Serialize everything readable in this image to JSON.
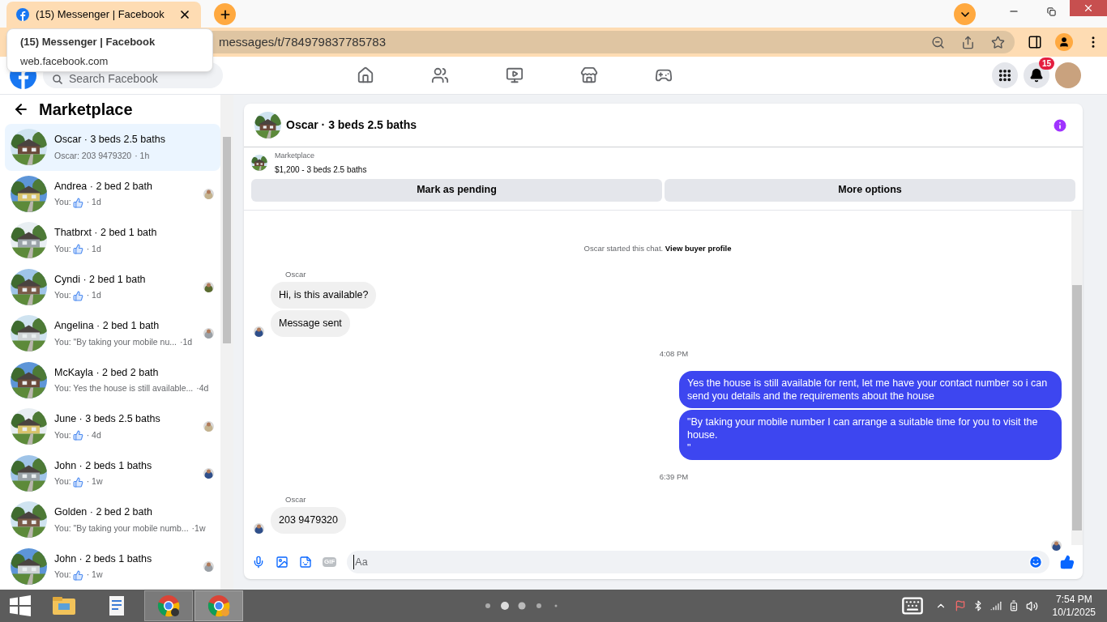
{
  "browser": {
    "tab_title": "(15) Messenger | Facebook",
    "tooltip": {
      "title": "(15) Messenger | Facebook",
      "url": "web.facebook.com"
    },
    "address": "messages/t/784979837785783"
  },
  "facebook": {
    "search_placeholder": "Search Facebook",
    "notification_count": "15"
  },
  "sidebar": {
    "title": "Marketplace",
    "conversations": [
      {
        "title": "Oscar · 3 beds 2.5 baths",
        "kind": "text",
        "preview": "Oscar: 203 9479320",
        "time": "· 1h",
        "selected": true,
        "receipt": false
      },
      {
        "title": "Andrea · 2 bed 2 bath",
        "kind": "like",
        "preview": "You:",
        "time": "· 1d",
        "selected": false,
        "receipt": true
      },
      {
        "title": "Thatbrxt · 2 bed 1 bath",
        "kind": "like",
        "preview": "You:",
        "time": "· 1d",
        "selected": false,
        "receipt": false
      },
      {
        "title": "Cyndi · 2 bed 1 bath",
        "kind": "like",
        "preview": "You:",
        "time": "· 1d",
        "selected": false,
        "receipt": true
      },
      {
        "title": "Angelina · 2 bed 1 bath",
        "kind": "text",
        "preview": "You: \"By taking your mobile nu...",
        "time": "·1d",
        "selected": false,
        "receipt": true
      },
      {
        "title": "McKayla · 2 bed 2 bath",
        "kind": "text",
        "preview": "You: Yes the house is still available...",
        "time": "·4d",
        "selected": false,
        "receipt": false
      },
      {
        "title": "June · 3 beds 2.5 baths",
        "kind": "like",
        "preview": "You:",
        "time": "· 4d",
        "selected": false,
        "receipt": true
      },
      {
        "title": "John · 2 beds 1 baths",
        "kind": "like",
        "preview": "You:",
        "time": "· 1w",
        "selected": false,
        "receipt": true
      },
      {
        "title": "Golden · 2 bed 2 bath",
        "kind": "text",
        "preview": "You: \"By taking your mobile numb...",
        "time": "·1w",
        "selected": false,
        "receipt": false
      },
      {
        "title": "John · 2 beds 1 baths",
        "kind": "like",
        "preview": "You:",
        "time": "· 1w",
        "selected": false,
        "receipt": true
      }
    ]
  },
  "chat": {
    "title": "Oscar · 3 beds 2.5 baths",
    "listing": {
      "label": "Marketplace",
      "summary": "$1,200 - 3 beds 2.5 baths"
    },
    "buttons": [
      "Mark as pending",
      "More options"
    ],
    "messages": [
      {
        "kind": "system",
        "text": "Oscar started this chat.",
        "link": "View buyer profile"
      },
      {
        "kind": "incoming",
        "sender": "Oscar",
        "bubbles": [
          "Hi, is this available?",
          "Message sent"
        ]
      },
      {
        "kind": "time",
        "text": "4:08 PM"
      },
      {
        "kind": "outgoing",
        "bubbles": [
          "Yes the house is still available for rent, let me have your contact number so i can send you details and the requirements about the house",
          "\"By taking your mobile number I can arrange a suitable time for you to visit the house.\n\""
        ]
      },
      {
        "kind": "time",
        "text": "6:39 PM"
      },
      {
        "kind": "incoming",
        "sender": "Oscar",
        "bubbles": [
          "203 9479320"
        ]
      }
    ],
    "seen": true,
    "composer": {
      "placeholder": "Aa",
      "gif": "GIF"
    }
  },
  "taskbar": {
    "time": "7:54 PM",
    "date": "10/1/2025"
  }
}
